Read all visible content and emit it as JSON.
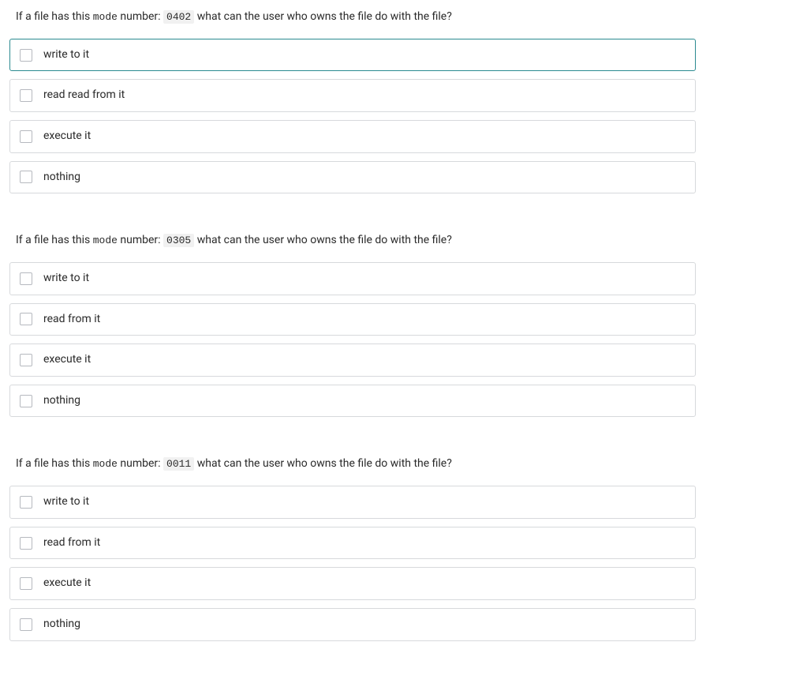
{
  "questions": [
    {
      "prompt_prefix": "If a file has this ",
      "mono_word": "mode",
      "prompt_mid": " number: ",
      "mode_number": "0402",
      "prompt_suffix": " what can the user who owns the file do with the file?",
      "answers": [
        {
          "label": "write to it",
          "highlighted": true
        },
        {
          "label": "read read from it",
          "highlighted": false
        },
        {
          "label": "execute it",
          "highlighted": false
        },
        {
          "label": "nothing",
          "highlighted": false
        }
      ]
    },
    {
      "prompt_prefix": "If a file has this ",
      "mono_word": "mode",
      "prompt_mid": " number: ",
      "mode_number": "0305",
      "prompt_suffix": " what can the user who owns the file do with the file?",
      "answers": [
        {
          "label": "write to it",
          "highlighted": false
        },
        {
          "label": "read from it",
          "highlighted": false
        },
        {
          "label": "execute it",
          "highlighted": false
        },
        {
          "label": "nothing",
          "highlighted": false
        }
      ]
    },
    {
      "prompt_prefix": "If a file has this ",
      "mono_word": "mode",
      "prompt_mid": " number: ",
      "mode_number": "0011",
      "prompt_suffix": " what can the user who owns the file do with the file?",
      "answers": [
        {
          "label": "write to it",
          "highlighted": false
        },
        {
          "label": "read from it",
          "highlighted": false
        },
        {
          "label": "execute it",
          "highlighted": false
        },
        {
          "label": "nothing",
          "highlighted": false
        }
      ]
    }
  ]
}
